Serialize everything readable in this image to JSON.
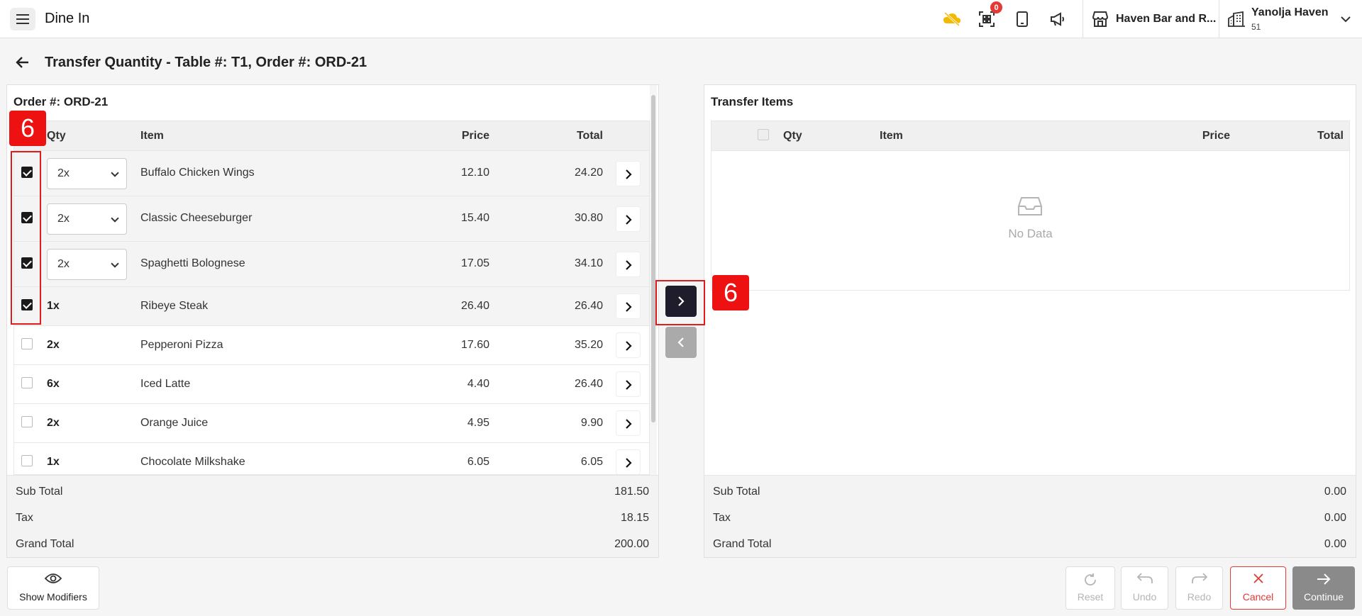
{
  "header": {
    "title": "Dine In",
    "notification_count": "0",
    "store_name": "Haven Bar and R...",
    "user_name": "Yanolja Haven",
    "user_sub": "51"
  },
  "page": {
    "title": "Transfer Quantity - Table #: T1, Order #: ORD-21"
  },
  "left_panel": {
    "title": "Order #: ORD-21",
    "columns": {
      "qty": "Qty",
      "item": "Item",
      "price": "Price",
      "total": "Total"
    },
    "rows": [
      {
        "checked": true,
        "qty": "2x",
        "item": "Buffalo Chicken Wings",
        "price": "12.10",
        "total": "24.20"
      },
      {
        "checked": true,
        "qty": "2x",
        "item": "Classic Cheeseburger",
        "price": "15.40",
        "total": "30.80"
      },
      {
        "checked": true,
        "qty": "2x",
        "item": "Spaghetti Bolognese",
        "price": "17.05",
        "total": "34.10"
      },
      {
        "checked": true,
        "qty": "1x",
        "item": "Ribeye Steak",
        "price": "26.40",
        "total": "26.40"
      },
      {
        "checked": false,
        "qty": "2x",
        "item": "Pepperoni Pizza",
        "price": "17.60",
        "total": "35.20"
      },
      {
        "checked": false,
        "qty": "6x",
        "item": "Iced Latte",
        "price": "4.40",
        "total": "26.40"
      },
      {
        "checked": false,
        "qty": "2x",
        "item": "Orange Juice",
        "price": "4.95",
        "total": "9.90"
      },
      {
        "checked": false,
        "qty": "1x",
        "item": "Chocolate Milkshake",
        "price": "6.05",
        "total": "6.05"
      }
    ],
    "totals": {
      "sub_total_label": "Sub Total",
      "sub_total": "181.50",
      "tax_label": "Tax",
      "tax": "18.15",
      "grand_total_label": "Grand Total",
      "grand_total": "200.00"
    }
  },
  "right_panel": {
    "title": "Transfer Items",
    "columns": {
      "qty": "Qty",
      "item": "Item",
      "price": "Price",
      "total": "Total"
    },
    "empty_text": "No Data",
    "totals": {
      "sub_total_label": "Sub Total",
      "sub_total": "0.00",
      "tax_label": "Tax",
      "tax": "0.00",
      "grand_total_label": "Grand Total",
      "grand_total": "0.00"
    }
  },
  "annotations": {
    "step_left": "6",
    "step_right": "6"
  },
  "footer": {
    "show_modifiers": "Show Modifiers",
    "reset": "Reset",
    "undo": "Undo",
    "redo": "Redo",
    "cancel": "Cancel",
    "continue": "Continue"
  },
  "colors": {
    "accent_dark": "#1f1d2b",
    "cancel_red": "#e53935",
    "annotation_red": "#ee1111",
    "badge_red": "#e53935"
  },
  "icons": [
    "menu-icon",
    "cloud-off-icon",
    "qr-code-icon",
    "tablet-icon",
    "megaphone-icon",
    "store-icon",
    "building-icon",
    "chevron-down-icon",
    "back-arrow-icon",
    "chevron-right-icon",
    "chevron-left-icon",
    "inbox-icon",
    "eye-icon",
    "reset-icon",
    "undo-icon",
    "redo-icon",
    "close-icon",
    "arrow-right-icon"
  ]
}
